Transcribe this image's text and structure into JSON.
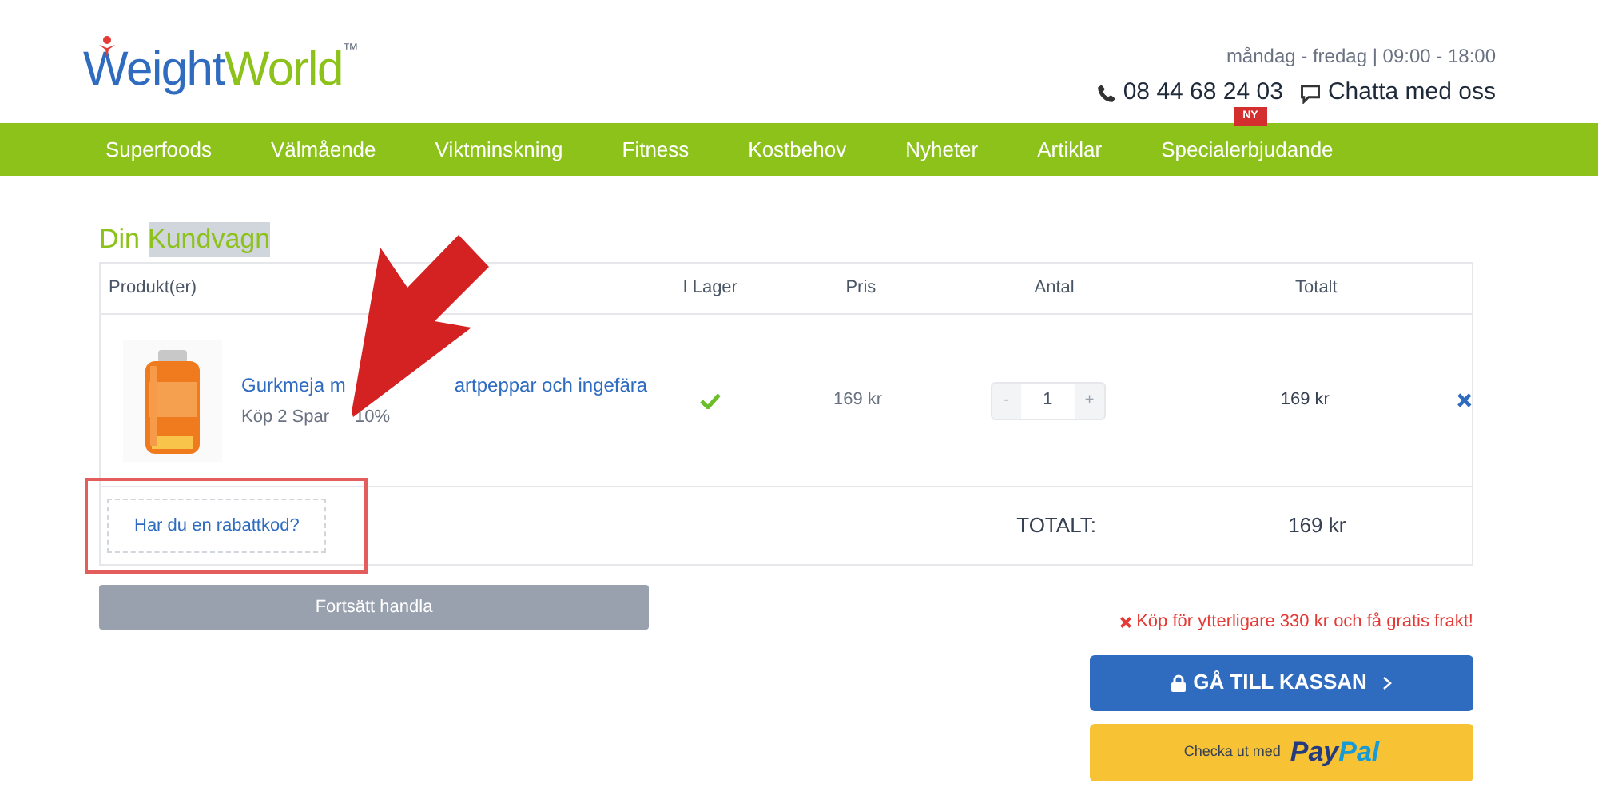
{
  "logo": {
    "first": "Weight",
    "second": "World",
    "mark": "™"
  },
  "contact": {
    "hours": "måndag - fredag | 09:00 - 18:00",
    "phone": "08 44 68 24 03",
    "chat": "Chatta med oss"
  },
  "nav": [
    {
      "label": "Superfoods"
    },
    {
      "label": "Välmående"
    },
    {
      "label": "Viktminskning"
    },
    {
      "label": "Fitness"
    },
    {
      "label": "Kostbehov"
    },
    {
      "label": "Nyheter"
    },
    {
      "label": "Artiklar"
    },
    {
      "label": "Specialerbjudande",
      "badge": "NY"
    }
  ],
  "cart_title": [
    {
      "text": "Din",
      "highlighted": false
    },
    {
      "text": "Kundvagn",
      "highlighted": true
    }
  ],
  "table": {
    "columns": [
      "Produkt(er)",
      "I Lager",
      "Pris",
      "Antal",
      "Totalt"
    ],
    "rows": [
      {
        "name_parts": [
          "Gurkmeja m",
          "artpeppar och ingefära"
        ],
        "promo_parts": [
          "Köp 2 Spar",
          "10%"
        ],
        "in_stock": true,
        "price": "169 kr",
        "quantity": "1",
        "minus": "-",
        "plus": "+",
        "total": "169 kr"
      }
    ],
    "coupon": "Har du en rabattkod?",
    "total_label": "TOTALT:",
    "total_value": "169 kr"
  },
  "continue_button": "Fortsätt handla",
  "shipping_note": "Köp för ytterligare 330 kr och få gratis frakt!",
  "checkout_button": "GÅ TILL KASSAN",
  "paypal_button": {
    "text": "Checka ut med",
    "brand_1": "Pay",
    "brand_2": "Pal"
  }
}
